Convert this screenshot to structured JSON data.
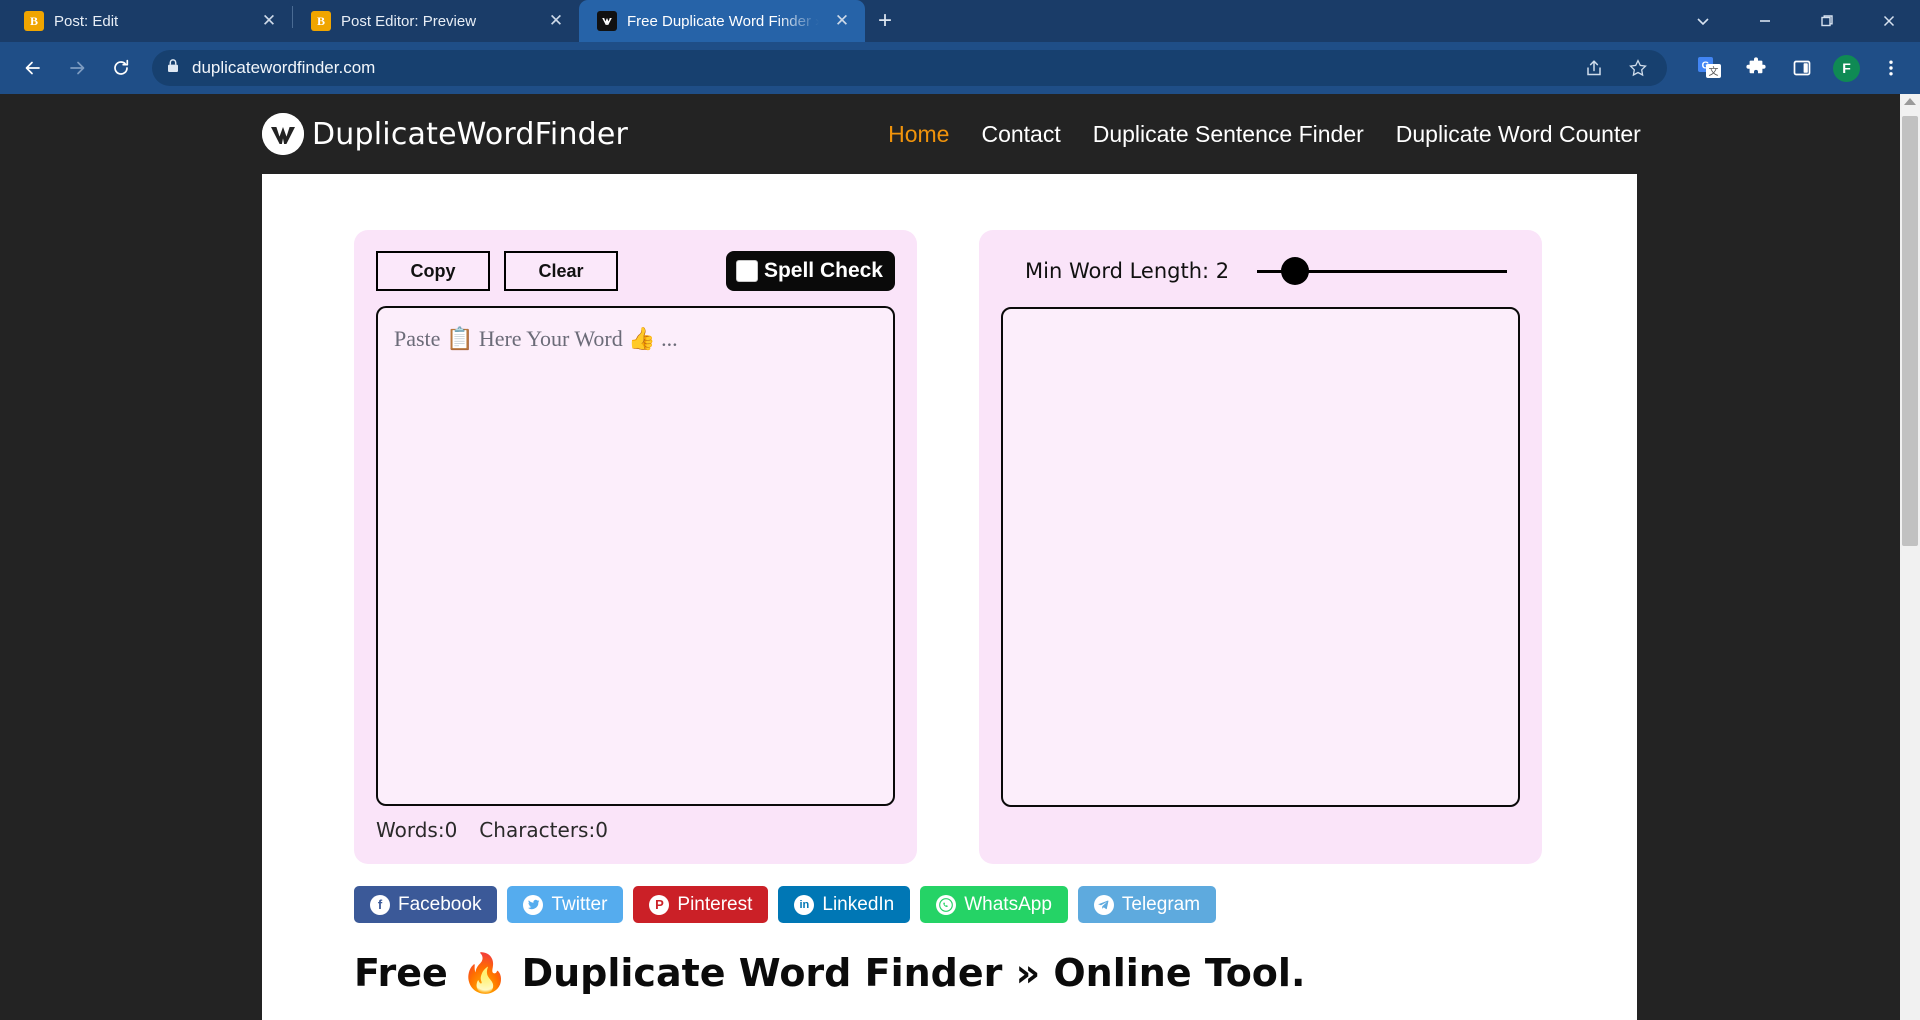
{
  "browser": {
    "tabs": [
      {
        "title": "Post: Edit",
        "favicon": "bloglovin-icon",
        "favicon_char": "B",
        "active": false
      },
      {
        "title": "Post Editor: Preview",
        "favicon": "bloglovin-icon",
        "favicon_char": "B",
        "active": false
      },
      {
        "title": "Free Duplicate Word Finder » On",
        "favicon": "duplicatewordfinder-icon",
        "favicon_char": "Ⓦ",
        "active": true
      }
    ],
    "new_tab_label": "+",
    "window_controls": {
      "tab_search": "⌄",
      "minimize": "—",
      "maximize": "❐",
      "close": "✕"
    },
    "nav": {
      "back": "←",
      "forward": "→",
      "reload": "⟳"
    },
    "omnibox": {
      "lock_icon": "lock-icon",
      "url": "duplicatewordfinder.com",
      "share_icon": "share-icon",
      "bookmark_icon": "star-icon"
    },
    "toolbar_icons": [
      {
        "name": "google-translate-icon",
        "glyph": "G"
      },
      {
        "name": "extensions-puzzle-icon",
        "glyph": "❖"
      },
      {
        "name": "side-panel-icon",
        "glyph": "⬜"
      }
    ],
    "profile": {
      "name": "profile-avatar",
      "initial": "F"
    },
    "menu_icon": "three-dot-menu-icon"
  },
  "site": {
    "brand": {
      "logo_name": "duplicatewordfinder-logo",
      "name": "DuplicateWordFinder"
    },
    "nav": [
      {
        "label": "Home",
        "active": true
      },
      {
        "label": "Contact",
        "active": false
      },
      {
        "label": "Duplicate Sentence Finder",
        "active": false
      },
      {
        "label": "Duplicate Word Counter",
        "active": false
      }
    ]
  },
  "tool": {
    "left_panel": {
      "copy_label": "Copy",
      "clear_label": "Clear",
      "spell_check_label": "Spell Check",
      "spell_check_checked": false,
      "input_placeholder": "Paste 📋 Here Your Word 👍 ...",
      "input_value": "",
      "words_label": "Words:0",
      "characters_label": "Characters:0"
    },
    "right_panel": {
      "min_word_length_label": "Min Word Length: 2",
      "min_word_length_value": 2,
      "slider_min": 1,
      "slider_max": 12,
      "output_value": ""
    }
  },
  "socials": [
    {
      "label": "Facebook",
      "glyph": "f",
      "color": "#3b5998"
    },
    {
      "label": "Twitter",
      "glyph": "ᵕ",
      "color": "#55acee"
    },
    {
      "label": "Pinterest",
      "glyph": "P",
      "color": "#cb2027"
    },
    {
      "label": "LinkedIn",
      "glyph": "in",
      "color": "#0077b5"
    },
    {
      "label": "WhatsApp",
      "glyph": "✆",
      "color": "#25d366"
    },
    {
      "label": "Telegram",
      "glyph": "➤",
      "color": "#5eaade"
    }
  ],
  "headline": "Free 🔥 Duplicate Word Finder » Online Tool."
}
